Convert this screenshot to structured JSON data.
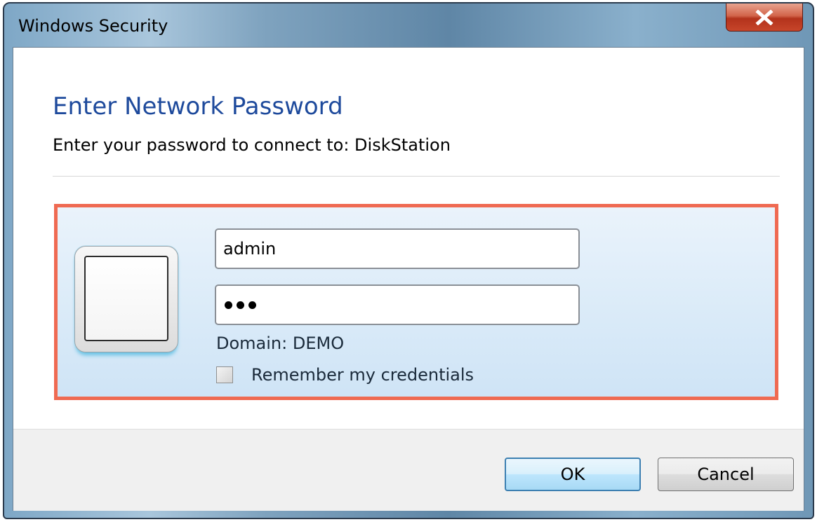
{
  "window": {
    "title": "Windows Security"
  },
  "dialog": {
    "heading": "Enter Network Password",
    "subtitle": "Enter your password to connect to: DiskStation"
  },
  "credentials": {
    "username": "admin",
    "password_dots": 3,
    "domain_label": "Domain: DEMO",
    "remember_label": "Remember my credentials",
    "remember_checked": false
  },
  "buttons": {
    "ok": "OK",
    "cancel": "Cancel"
  },
  "colors": {
    "heading": "#1e4a9c",
    "highlight_border": "#ef6a52",
    "close_button": "#c7452a"
  }
}
